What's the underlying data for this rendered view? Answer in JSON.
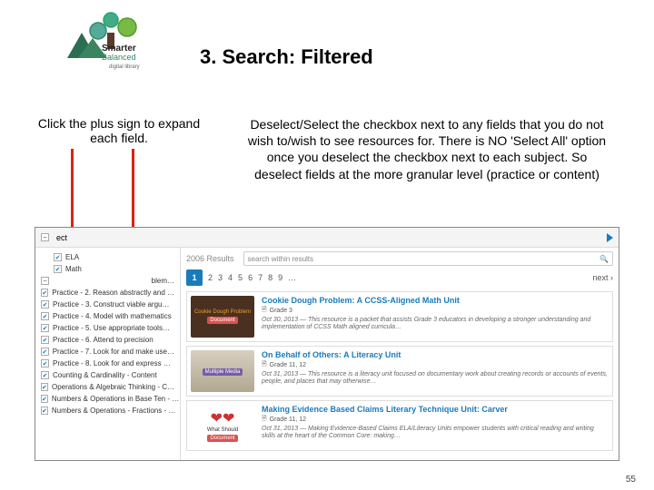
{
  "slide": {
    "title": "3. Search: Filtered",
    "left_instruction": "Click the plus sign to expand each field.",
    "right_instruction": "Deselect/Select the checkbox next to any fields that you do not wish to/wish to see resources for. There is NO 'Select All' option once you deselect the checkbox next to each subject. So deselect fields at the more granular level (practice or content)",
    "page_number": "55"
  },
  "app": {
    "header": {
      "collapse_label": "ect",
      "subjects": [
        "ELA",
        "Math"
      ]
    },
    "sidebar": {
      "problem_row": "blem…",
      "items": [
        "Practice - 2. Reason abstractly and …",
        "Practice - 3. Construct viable argu…",
        "Practice - 4. Model with mathematics",
        "Practice - 5. Use appropriate tools…",
        "Practice - 6. Attend to precision",
        "Practice - 7. Look for and make use…",
        "Practice - 8. Look for and express …",
        "Counting & Cardinality - Content",
        "Operations & Algebraic Thinking - C…",
        "Numbers & Operations in Base Ten - …",
        "Numbers & Operations - Fractions - …"
      ]
    },
    "results_count": "2006 Results",
    "search_placeholder": "search within results",
    "pagination": {
      "current": "1",
      "pages": [
        "2",
        "3",
        "4",
        "5",
        "6",
        "7",
        "8",
        "9",
        "…"
      ],
      "next": "next ›"
    },
    "results": [
      {
        "thumb_text": "Cookie Dough Problem",
        "thumb_label": "Document",
        "thumb_label_color": "red",
        "title": "Cookie Dough Problem: A CCSS-Aligned Math Unit",
        "grade": "Grade 3",
        "date": "Oct 30, 2013",
        "desc": "This resource is a packet that assists Grade 3 educators in developing a stronger understanding and implementation of CCSS Math aligned curricula…"
      },
      {
        "thumb_text": "",
        "thumb_label": "Multiple Media",
        "thumb_label_color": "purple",
        "title": "On Behalf of Others: A Literacy Unit",
        "grade": "Grade 11, 12",
        "date": "Oct 31, 2013",
        "desc": "This resource is a literacy unit focused on documentary work about creating records or accounts of events, people, and places that may otherwise…"
      },
      {
        "thumb_text": "What Should",
        "thumb_label": "Document",
        "thumb_label_color": "red",
        "title": "Making Evidence Based Claims Literary Technique Unit: Carver",
        "grade": "Grade 11, 12",
        "date": "Oct 31, 2013",
        "desc": "Making Evidence-Based Claims ELA/Literacy Units empower students with critical reading and writing skills at the heart of the Common Core: making…"
      }
    ]
  }
}
